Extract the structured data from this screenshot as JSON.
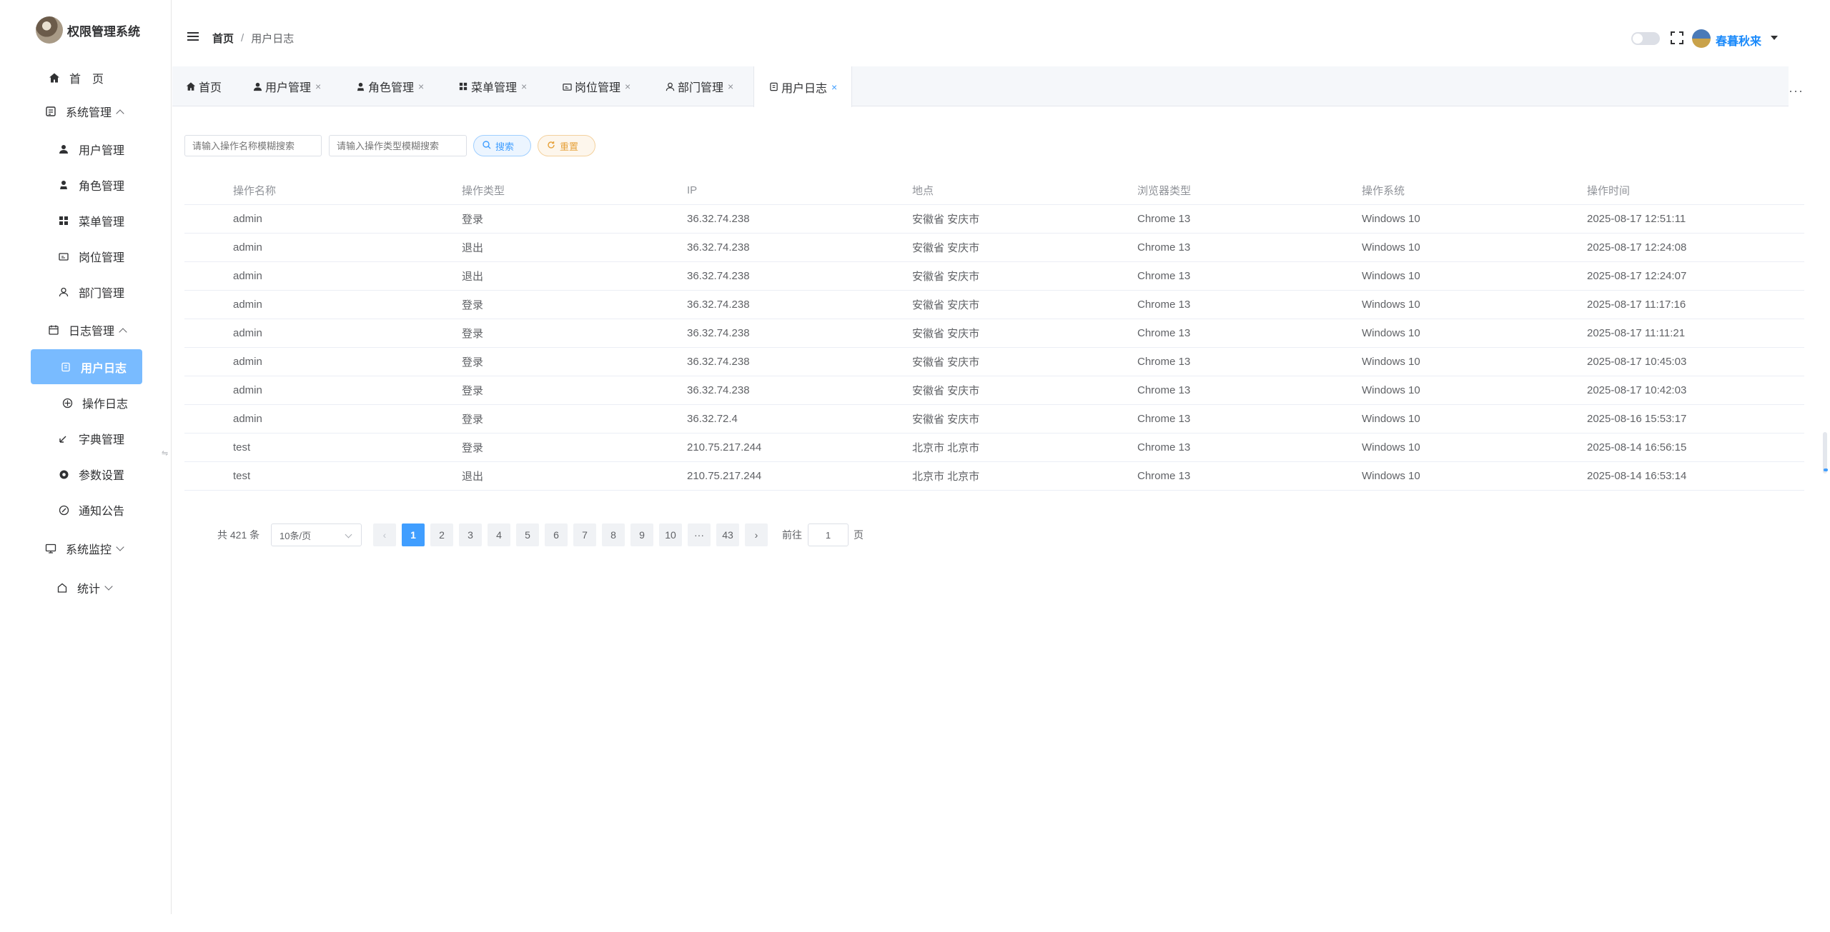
{
  "app": {
    "title": "权限管理系统"
  },
  "sidebar": {
    "items": [
      {
        "label": "首　页",
        "icon": "home-icon"
      },
      {
        "label": "系统管理",
        "icon": "system-icon",
        "expanded": true
      },
      {
        "label": "用户管理",
        "icon": "user-icon"
      },
      {
        "label": "角色管理",
        "icon": "role-icon"
      },
      {
        "label": "菜单管理",
        "icon": "menu-grid-icon"
      },
      {
        "label": "岗位管理",
        "icon": "post-icon"
      },
      {
        "label": "部门管理",
        "icon": "dept-icon"
      },
      {
        "label": "日志管理",
        "icon": "calendar-icon",
        "expanded": true
      },
      {
        "label": "用户日志",
        "icon": "log-icon",
        "active": true
      },
      {
        "label": "操作日志",
        "icon": "operation-icon"
      },
      {
        "label": "字典管理",
        "icon": "dictionary-icon"
      },
      {
        "label": "参数设置",
        "icon": "settings-icon"
      },
      {
        "label": "通知公告",
        "icon": "notice-icon"
      },
      {
        "label": "系统监控",
        "icon": "monitor-icon",
        "expanded": false
      },
      {
        "label": "统计",
        "icon": "stats-icon",
        "expanded": false
      }
    ]
  },
  "header": {
    "breadcrumb": {
      "home": "首页",
      "separator": "/",
      "current": "用户日志"
    },
    "user": {
      "name": "春暮秋来"
    }
  },
  "tabs": [
    {
      "label": "首页",
      "icon": "home-icon",
      "closable": false
    },
    {
      "label": "用户管理",
      "icon": "user-icon",
      "closable": true
    },
    {
      "label": "角色管理",
      "icon": "role-icon",
      "closable": true
    },
    {
      "label": "菜单管理",
      "icon": "menu-grid-icon",
      "closable": true
    },
    {
      "label": "岗位管理",
      "icon": "post-icon",
      "closable": true
    },
    {
      "label": "部门管理",
      "icon": "dept-icon",
      "closable": true
    },
    {
      "label": "用户日志",
      "icon": "log-icon",
      "closable": true,
      "active": true
    }
  ],
  "search": {
    "name_placeholder": "请输入操作名称模糊搜索",
    "type_placeholder": "请输入操作类型模糊搜索",
    "search_label": "搜索",
    "reset_label": "重置"
  },
  "table": {
    "columns": [
      "操作名称",
      "操作类型",
      "IP",
      "地点",
      "浏览器类型",
      "操作系统",
      "操作时间"
    ],
    "rows": [
      [
        "admin",
        "登录",
        "36.32.74.238",
        "安徽省 安庆市",
        "Chrome 13",
        "Windows 10",
        "2025-08-17 12:51:11"
      ],
      [
        "admin",
        "退出",
        "36.32.74.238",
        "安徽省 安庆市",
        "Chrome 13",
        "Windows 10",
        "2025-08-17 12:24:08"
      ],
      [
        "admin",
        "退出",
        "36.32.74.238",
        "安徽省 安庆市",
        "Chrome 13",
        "Windows 10",
        "2025-08-17 12:24:07"
      ],
      [
        "admin",
        "登录",
        "36.32.74.238",
        "安徽省 安庆市",
        "Chrome 13",
        "Windows 10",
        "2025-08-17 11:17:16"
      ],
      [
        "admin",
        "登录",
        "36.32.74.238",
        "安徽省 安庆市",
        "Chrome 13",
        "Windows 10",
        "2025-08-17 11:11:21"
      ],
      [
        "admin",
        "登录",
        "36.32.74.238",
        "安徽省 安庆市",
        "Chrome 13",
        "Windows 10",
        "2025-08-17 10:45:03"
      ],
      [
        "admin",
        "登录",
        "36.32.74.238",
        "安徽省 安庆市",
        "Chrome 13",
        "Windows 10",
        "2025-08-17 10:42:03"
      ],
      [
        "admin",
        "登录",
        "36.32.72.4",
        "安徽省 安庆市",
        "Chrome 13",
        "Windows 10",
        "2025-08-16 15:53:17"
      ],
      [
        "test",
        "登录",
        "210.75.217.244",
        "北京市 北京市",
        "Chrome 13",
        "Windows 10",
        "2025-08-14 16:56:15"
      ],
      [
        "test",
        "退出",
        "210.75.217.244",
        "北京市 北京市",
        "Chrome 13",
        "Windows 10",
        "2025-08-14 16:53:14"
      ]
    ]
  },
  "pagination": {
    "total_text": "共 421 条",
    "page_size": "10条/页",
    "pages": [
      "1",
      "2",
      "3",
      "4",
      "5",
      "6",
      "7",
      "8",
      "9",
      "10",
      "···",
      "43"
    ],
    "current_page": "1",
    "goto_prefix": "前往",
    "goto_value": "1",
    "goto_suffix": "页"
  },
  "colors": {
    "primary": "#409eff",
    "active_menu_bg": "#79bbff",
    "reset_accent": "#e6a23c"
  }
}
